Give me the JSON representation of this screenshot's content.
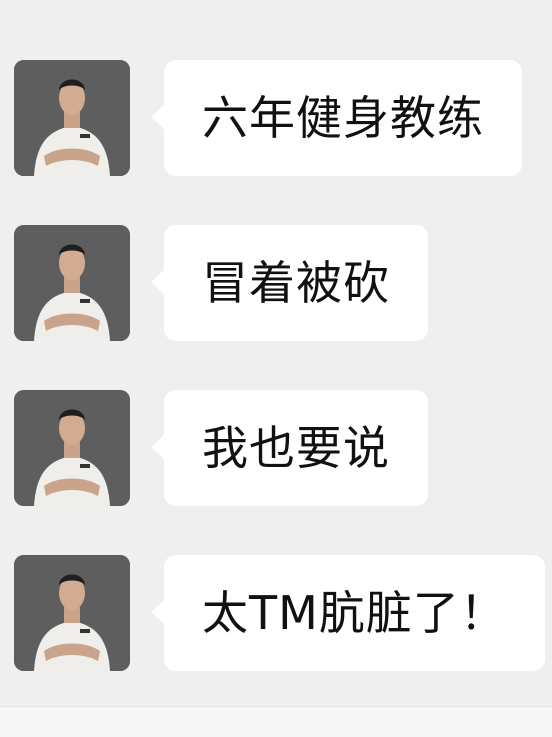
{
  "messages": [
    {
      "text": "六年健身教练"
    },
    {
      "text": "冒着被砍"
    },
    {
      "text": "我也要说"
    },
    {
      "text": "太TM肮脏了！"
    }
  ],
  "colors": {
    "background": "#efefef",
    "bubble": "#ffffff",
    "text": "#111111",
    "avatar_bg": "#5b5b5b"
  },
  "icons": {
    "avatar": "trainer-photo-icon"
  }
}
